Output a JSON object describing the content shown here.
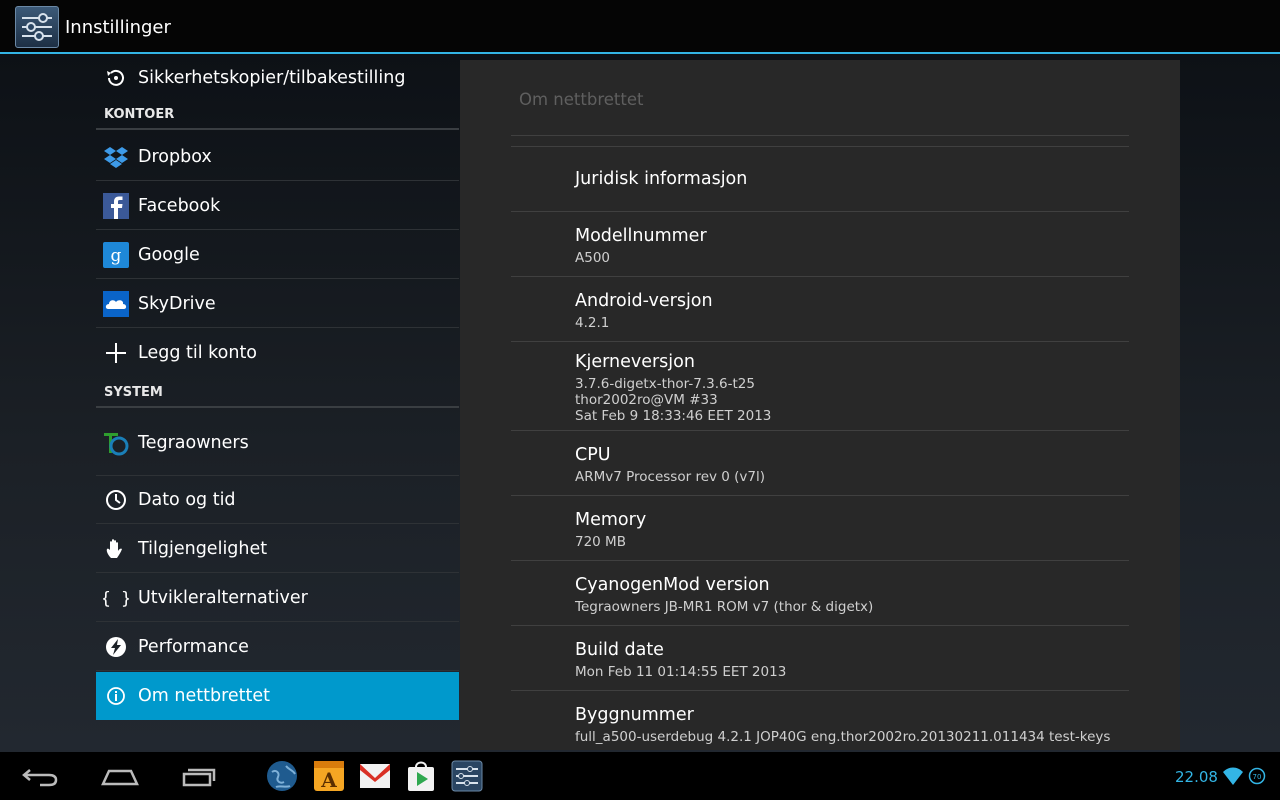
{
  "actionbar": {
    "title": "Innstillinger",
    "icon": "settings-icon"
  },
  "headers": {
    "top_item": {
      "label": "Sikkerhetskopier/tilbakestilling",
      "icon": "backup-restore-icon"
    },
    "category_accounts": "KONTOER",
    "accounts": [
      {
        "label": "Dropbox",
        "icon": "dropbox-icon"
      },
      {
        "label": "Facebook",
        "icon": "facebook-icon"
      },
      {
        "label": "Google",
        "icon": "google-icon"
      },
      {
        "label": "SkyDrive",
        "icon": "skydrive-icon"
      },
      {
        "label": "Legg til konto",
        "icon": "plus-icon"
      }
    ],
    "category_system": "SYSTEM",
    "system": [
      {
        "label": "Tegraowners",
        "icon": "tegraowners-icon"
      },
      {
        "label": "Dato og tid",
        "icon": "clock-icon"
      },
      {
        "label": "Tilgjengelighet",
        "icon": "hand-icon"
      },
      {
        "label": "Utvikleralternativer",
        "icon": "braces-icon"
      },
      {
        "label": "Performance",
        "icon": "lightning-icon"
      },
      {
        "label": "Om nettbrettet",
        "icon": "info-icon",
        "selected": true
      }
    ]
  },
  "detail": {
    "title": "Om nettbrettet",
    "items": [
      {
        "title": "Juridisk informasjon",
        "summary": ""
      },
      {
        "title": "Modellnummer",
        "summary": "A500"
      },
      {
        "title": "Android-versjon",
        "summary": "4.2.1"
      },
      {
        "title": "Kjerneversjon",
        "summary": "3.7.6-digetx-thor-7.3.6-t25\nthor2002ro@VM #33\nSat Feb 9 18:33:46 EET 2013"
      },
      {
        "title": "CPU",
        "summary": "ARMv7 Processor rev 0 (v7l)"
      },
      {
        "title": "Memory",
        "summary": "720 MB"
      },
      {
        "title": "CyanogenMod version",
        "summary": "Tegraowners JB-MR1 ROM v7 (thor & digetx)"
      },
      {
        "title": "Build date",
        "summary": "Mon Feb 11 01:14:55 EET 2013"
      },
      {
        "title": "Byggnummer",
        "summary": "full_a500-userdebug 4.2.1 JOP40G eng.thor2002ro.20130211.011434 test-keys"
      }
    ]
  },
  "navbar": {
    "buttons": [
      "back-icon",
      "home-icon",
      "recent-apps-icon"
    ],
    "apps": [
      "browser-icon",
      "aldiko-icon",
      "gmail-icon",
      "play-store-icon",
      "settings-icon"
    ],
    "clock": "22.08",
    "battery_level": "70"
  },
  "colors": {
    "accent": "#33b5e5",
    "selected": "#0099cc"
  }
}
